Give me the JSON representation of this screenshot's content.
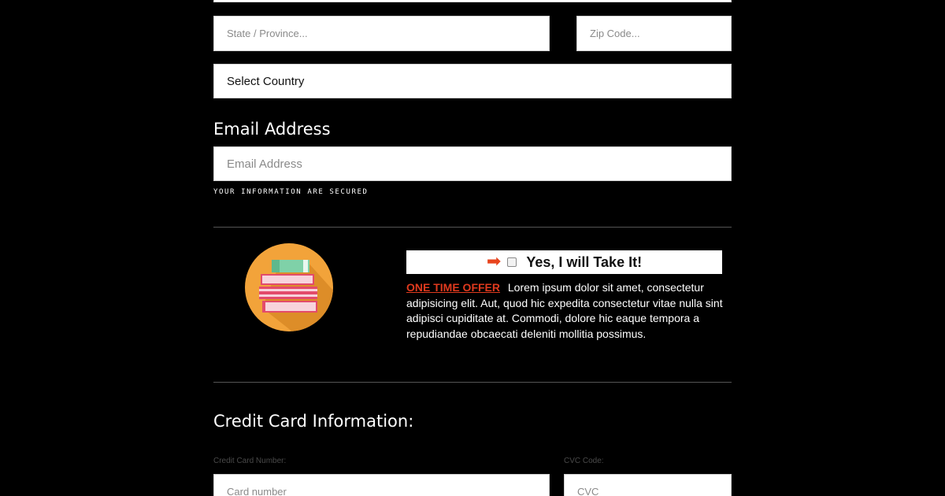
{
  "form": {
    "state_placeholder": "State / Province...",
    "zip_placeholder": "Zip Code...",
    "country_select": "Select Country",
    "email_heading": "Email Address",
    "email_placeholder": "Email Address",
    "secured_note": "YOUR INFORMATION ARE SECURED"
  },
  "offer": {
    "icon": "books-stack-icon",
    "take_label": "Yes, I will Take It!",
    "offer_tag": "ONE TIME OFFER",
    "description": "Lorem ipsum dolor sit amet, consectetur adipisicing elit. Aut, quod hic expedita consectetur vitae nulla sint adipisci cupiditate at. Commodi, dolore hic eaque tempora a repudiandae obcaecati deleniti mollitia possimus."
  },
  "card": {
    "heading": "Credit Card Information:",
    "number_label": "Credit Card Number:",
    "number_placeholder": "Card number",
    "cvc_label": "CVC Code:",
    "cvc_placeholder": "CVC"
  },
  "colors": {
    "background": "#000000",
    "offer_accent": "#e03a1e",
    "icon_circle": "#f2a33a"
  }
}
